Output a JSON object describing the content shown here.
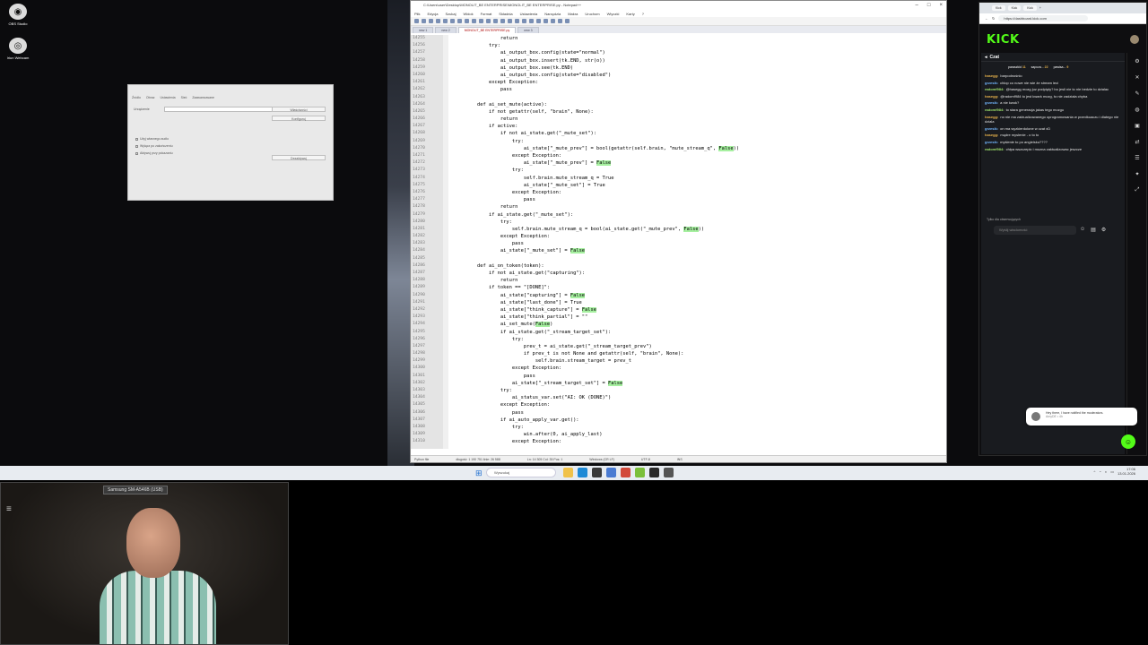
{
  "desktop": {
    "icons": [
      {
        "label": "OBS Studio",
        "glyph": "◉"
      },
      {
        "label": "Iriun Webcam",
        "glyph": "◎"
      }
    ]
  },
  "obs_dialog": {
    "tabs": [
      "Źródło",
      "Obraz",
      "Ustawienia",
      "Sieć",
      "Zaawansowane"
    ],
    "field_label": "Urządzenie",
    "buttons": [
      "Właściwości",
      "Konfiguruj",
      "Dezaktywuj"
    ],
    "checkboxes": [
      "Użyj własnego audio",
      "Wyłącz po zakończeniu",
      "Aktywuj przy pokazaniu"
    ]
  },
  "editor": {
    "title": "C:\\Users\\user\\Desktop\\MONOLIT_BE ENTERPRISE\\MONOLIT_BE ENTERPRISE.py - Notepad++",
    "menu": [
      "Plik",
      "Edycja",
      "Szukaj",
      "Widok",
      "Format",
      "Składnia",
      "Ustawienia",
      "Narzędzia",
      "Makra",
      "Uruchom",
      "Wtyczki",
      "Karty",
      "?"
    ],
    "tabs": [
      {
        "label": "new 1",
        "active": false
      },
      {
        "label": "new 2",
        "active": false
      },
      {
        "label": "MONOLIT_BE ENTERPRISE.py",
        "active": true
      },
      {
        "label": "new 3",
        "active": false
      }
    ],
    "status": [
      "Python file",
      "długość: 1 190 751   linie: 26 588",
      "Ln: 14 305   Col: 35   Pos: 1",
      "Windows (CR LF)",
      "UTF-8",
      "INS"
    ],
    "lines": [
      {
        "n": "14255",
        "t": "                return"
      },
      {
        "n": "14256",
        "t": "            try:"
      },
      {
        "n": "14257",
        "t": "                ai_output_box.config(state=\"normal\")"
      },
      {
        "n": "14258",
        "t": "                ai_output_box.insert(tk.END, str(o))"
      },
      {
        "n": "14259",
        "t": "                ai_output_box.see(tk.END)"
      },
      {
        "n": "14260",
        "t": "                ai_output_box.config(state=\"disabled\")"
      },
      {
        "n": "14261",
        "t": "            except Exception:"
      },
      {
        "n": "14262",
        "t": "                pass"
      },
      {
        "n": "14263",
        "t": ""
      },
      {
        "n": "14264",
        "t": "        def ai_set_mute(active):"
      },
      {
        "n": "14265",
        "t": "            if not getattr(self, \"brain\", None):"
      },
      {
        "n": "14266",
        "t": "                return"
      },
      {
        "n": "14267",
        "t": "            if active:"
      },
      {
        "n": "14268",
        "t": "                if not ai_state.get(\"_mute_set\"):"
      },
      {
        "n": "14269",
        "t": "                    try:"
      },
      {
        "n": "14270",
        "t": "                        ai_state[\"_mute_prev\"] = bool(getattr(self.brain, \"mute_stream_q\", False))"
      },
      {
        "n": "14271",
        "t": "                    except Exception:"
      },
      {
        "n": "14272",
        "t": "                        ai_state[\"_mute_prev\"] = False"
      },
      {
        "n": "14273",
        "t": "                    try:"
      },
      {
        "n": "14274",
        "t": "                        self.brain.mute_stream_q = True"
      },
      {
        "n": "14275",
        "t": "                        ai_state[\"_mute_set\"] = True"
      },
      {
        "n": "14276",
        "t": "                    except Exception:"
      },
      {
        "n": "14277",
        "t": "                        pass"
      },
      {
        "n": "14278",
        "t": "                return"
      },
      {
        "n": "14279",
        "t": "            if ai_state.get(\"_mute_set\"):"
      },
      {
        "n": "14280",
        "t": "                try:"
      },
      {
        "n": "14281",
        "t": "                    self.brain.mute_stream_q = bool(ai_state.get(\"_mute_prev\", False))"
      },
      {
        "n": "14282",
        "t": "                except Exception:"
      },
      {
        "n": "14283",
        "t": "                    pass"
      },
      {
        "n": "14284",
        "t": "                ai_state[\"_mute_set\"] = False"
      },
      {
        "n": "14285",
        "t": ""
      },
      {
        "n": "14286",
        "t": "        def ai_on_token(token):"
      },
      {
        "n": "14287",
        "t": "            if not ai_state.get(\"capturing\"):"
      },
      {
        "n": "14288",
        "t": "                return"
      },
      {
        "n": "14289",
        "t": "            if token == \"[DONE]\":"
      },
      {
        "n": "14290",
        "t": "                ai_state[\"capturing\"] = False"
      },
      {
        "n": "14291",
        "t": "                ai_state[\"last_done\"] = True"
      },
      {
        "n": "14292",
        "t": "                ai_state[\"think_capture\"] = False"
      },
      {
        "n": "14293",
        "t": "                ai_state[\"think_partial\"] = \"\""
      },
      {
        "n": "14294",
        "t": "                ai_set_mute(False)"
      },
      {
        "n": "14295",
        "t": "                if ai_state.get(\"_stream_target_set\"):"
      },
      {
        "n": "14296",
        "t": "                    try:"
      },
      {
        "n": "14297",
        "t": "                        prev_t = ai_state.get(\"_stream_target_prev\")"
      },
      {
        "n": "14298",
        "t": "                        if prev_t is not None and getattr(self, \"brain\", None):"
      },
      {
        "n": "14299",
        "t": "                            self.brain.stream_target = prev_t"
      },
      {
        "n": "14300",
        "t": "                    except Exception:"
      },
      {
        "n": "14301",
        "t": "                        pass"
      },
      {
        "n": "14302",
        "t": "                    ai_state[\"_stream_target_set\"] = False"
      },
      {
        "n": "14303",
        "t": "                try:"
      },
      {
        "n": "14304",
        "t": "                    ai_status_var.set(\"AI: OK (DONE)\")"
      },
      {
        "n": "14305",
        "t": "                except Exception:"
      },
      {
        "n": "14306",
        "t": "                    pass"
      },
      {
        "n": "14307",
        "t": "                if ai_auto_apply_var.get():"
      },
      {
        "n": "14308",
        "t": "                    try:"
      },
      {
        "n": "14309",
        "t": "                        win.after(0, ai_apply_last)"
      },
      {
        "n": "14310",
        "t": "                    except Exception:"
      }
    ]
  },
  "browser": {
    "tabs": [
      "Kick",
      "Kick",
      "Kick"
    ],
    "url": "https://dashboard.kick.com",
    "logo": "KICK",
    "chat_title": "Czat",
    "pinned": [
      {
        "user": "paraszkid",
        "badge": "11"
      },
      {
        "user": "sapcza...",
        "badge": "22"
      },
      {
        "user": "pawisa...",
        "badge": "9"
      }
    ],
    "messages": [
      {
        "user": "hasegg:",
        "color": "#e9b44c",
        "text": "barpodnośnio"
      },
      {
        "user": "grzesik:",
        "color": "#73b7ff",
        "text": "chłop co nowe nie wie że stream leci"
      },
      {
        "user": "radomf984:",
        "color": "#9ee26b",
        "text": "@hasegg mozg juz podpięty? bo jesli nie to nie bedzie to dzialac"
      },
      {
        "user": "hasegg:",
        "color": "#e9b44c",
        "text": "@radomf984 to jest kwark mozg, to nie zadziała chyba"
      },
      {
        "user": "grzesik:",
        "color": "#73b7ff",
        "text": "a nie kwok?"
      },
      {
        "user": "radomf984:",
        "color": "#9ee26b",
        "text": "to stara generacja jakas tego mozgu"
      },
      {
        "user": "hasegg:",
        "color": "#e9b44c",
        "text": "no nie ma zaktualizowanego oprogramowania w przedkuaczu i dlatego nie dziala"
      },
      {
        "user": "grzesik:",
        "color": "#73b7ff",
        "text": "on ma wyzkierdolone w czat xD"
      },
      {
        "user": "hasegg:",
        "color": "#e9b44c",
        "text": "mądre myslenie - o to to"
      },
      {
        "user": "grzesik:",
        "color": "#73b7ff",
        "text": "myślenie to po angielsku????"
      },
      {
        "user": "radomf984:",
        "color": "#9ee26b",
        "text": "chłpa wszczepic i mozna zaktualizowac jeszcze"
      }
    ],
    "reply_hint": "Tylko dla obserwujących",
    "input_placeholder": "Wyślij wiadomość",
    "toast_line1": "Hey there, I have notified the moderators.",
    "toast_line2": "AmyDE • 4h"
  },
  "taskbar": {
    "search_placeholder": "Wyszukaj",
    "time": "17:06",
    "date": "13.01.2026"
  },
  "webcam": {
    "label": "Samsung SM-A546B (USB)"
  }
}
